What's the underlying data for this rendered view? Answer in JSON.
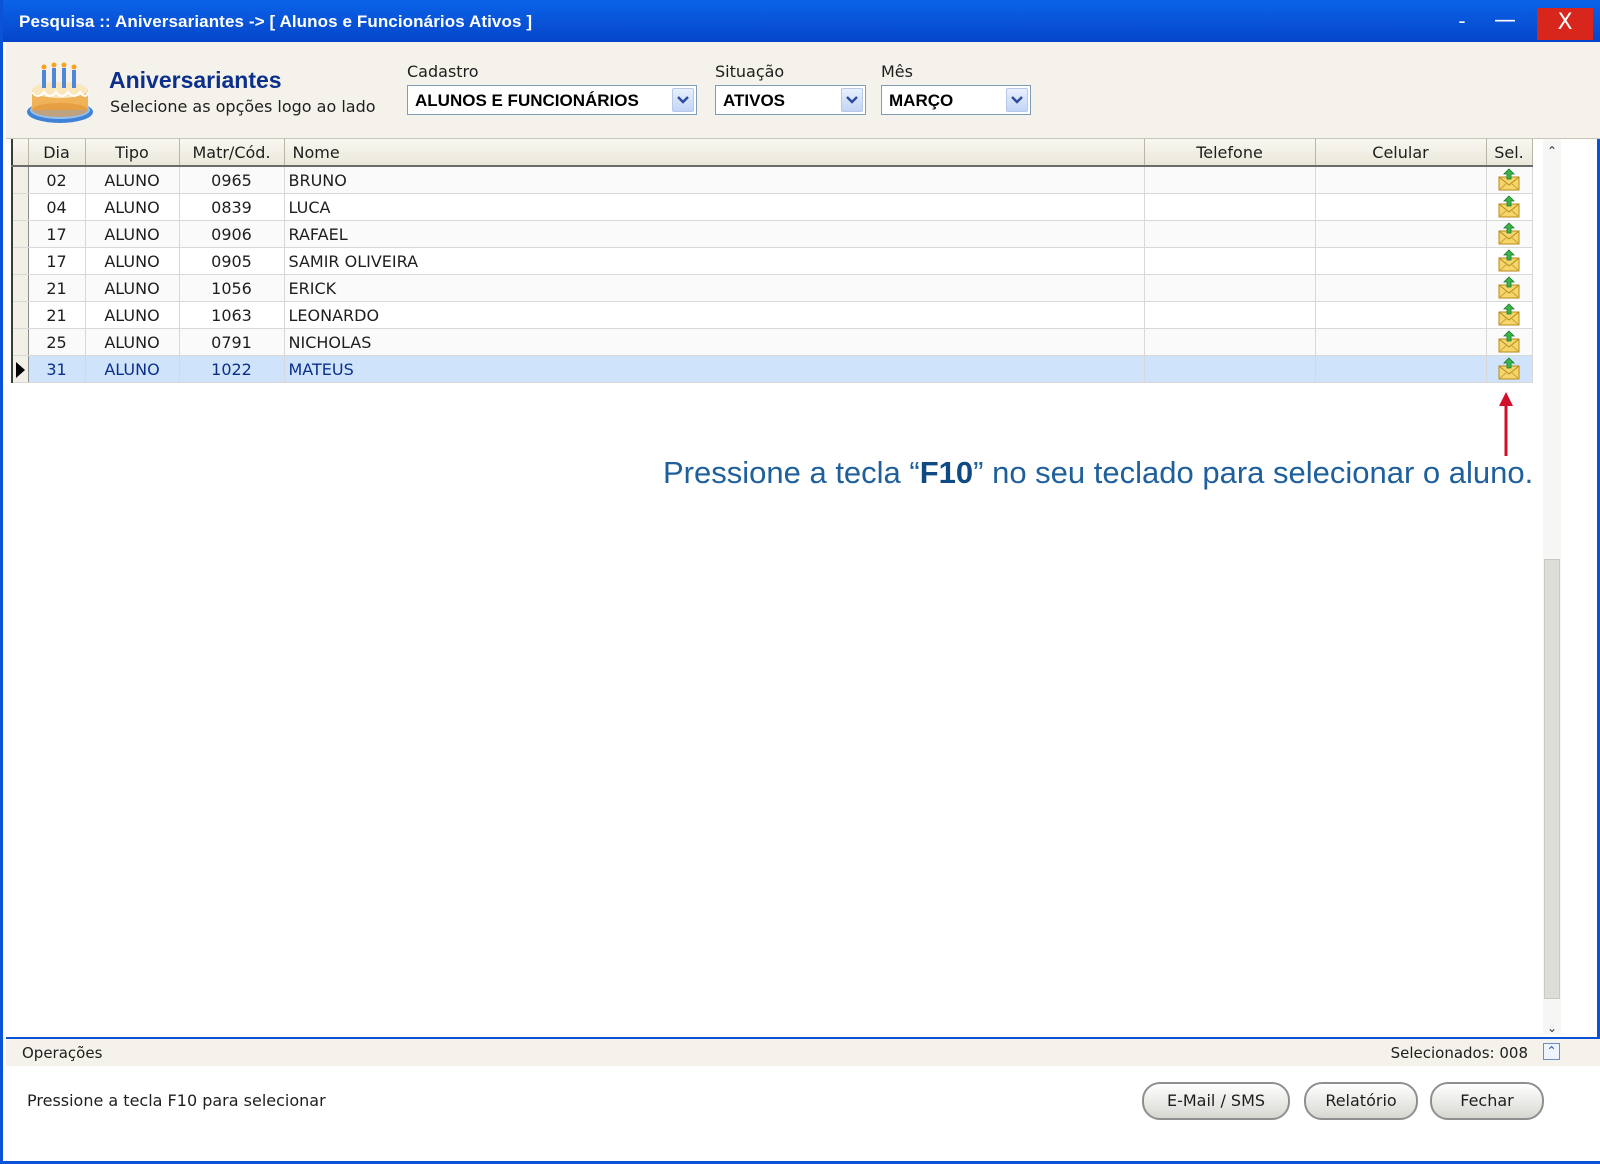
{
  "window": {
    "title": "Pesquisa :: Aniversariantes -> [ Alunos e Funcionários Ativos ]",
    "controls": {
      "min1": "-",
      "min2": "—",
      "close": "X"
    }
  },
  "header": {
    "title": "Aniversariantes",
    "subtitle": "Selecione as opções logo ao lado",
    "cadastro": {
      "label": "Cadastro",
      "value": "ALUNOS E FUNCIONÁRIOS"
    },
    "situacao": {
      "label": "Situação",
      "value": "ATIVOS"
    },
    "mes": {
      "label": "Mês",
      "value": "MARÇO"
    }
  },
  "grid": {
    "columns": [
      "Dia",
      "Tipo",
      "Matr/Cód.",
      "Nome",
      "Telefone",
      "Celular",
      "Sel."
    ],
    "rows": [
      {
        "dia": "02",
        "tipo": "ALUNO",
        "matr": "0965",
        "nome": "BRUNO",
        "telefone": "",
        "celular": ""
      },
      {
        "dia": "04",
        "tipo": "ALUNO",
        "matr": "0839",
        "nome": "LUCA",
        "telefone": "",
        "celular": ""
      },
      {
        "dia": "17",
        "tipo": "ALUNO",
        "matr": "0906",
        "nome": "RAFAEL",
        "telefone": "",
        "celular": ""
      },
      {
        "dia": "17",
        "tipo": "ALUNO",
        "matr": "0905",
        "nome": "SAMIR OLIVEIRA",
        "telefone": "",
        "celular": ""
      },
      {
        "dia": "21",
        "tipo": "ALUNO",
        "matr": "1056",
        "nome": "ERICK",
        "telefone": "",
        "celular": ""
      },
      {
        "dia": "21",
        "tipo": "ALUNO",
        "matr": "1063",
        "nome": "LEONARDO",
        "telefone": "",
        "celular": ""
      },
      {
        "dia": "25",
        "tipo": "ALUNO",
        "matr": "0791",
        "nome": "NICHOLAS",
        "telefone": "",
        "celular": ""
      },
      {
        "dia": "31",
        "tipo": "ALUNO",
        "matr": "1022",
        "nome": "MATEUS",
        "telefone": "",
        "celular": ""
      }
    ],
    "selected_row": 7,
    "row_icon": "email-send-icon"
  },
  "annotation": {
    "before": "Pressione a tecla “",
    "key": "F10",
    "after": "” no seu teclado para selecionar o aluno.",
    "arrow_color": "#d0102b"
  },
  "operations": {
    "label": "Operações",
    "selected": "Selecionados: 008"
  },
  "footer": {
    "hint": "Pressione a tecla F10 para selecionar",
    "buttons": {
      "email": "E-Mail / SMS",
      "report": "Relatório",
      "close": "Fechar"
    }
  },
  "colors": {
    "title_bar": "#0a53d6",
    "close": "#d8261c",
    "selected_row": "#cfe3fb",
    "annotation": "#1e5f9c"
  }
}
